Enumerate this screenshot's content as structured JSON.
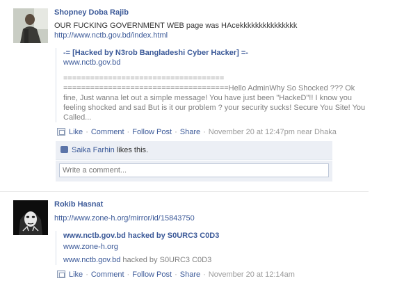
{
  "posts": [
    {
      "author": "Shopney Doba Rajib",
      "message": "OUR FUCKING GOVERNMENT WEB page was HAcekkkkkkkkkkkkkkk",
      "link": "http://www.nctb.gov.bd/index.html",
      "attachment": {
        "title": "-= [Hacked by N3rob Bangladeshi Cyber Hacker] =-",
        "caption": "www.nctb.gov.bd",
        "description_line1": "====================================",
        "description_rest": "=====================================Hello AdminWhy So Shocked ??? Ok fine, Just wanna let out a simple message! You have just been \"HackeD\"!! I know you feeling shocked and sad But is it our problem ? your security sucks! Secure You Site! You Called..."
      },
      "actions": {
        "like": "Like",
        "comment": "Comment",
        "follow": "Follow Post",
        "share": "Share",
        "time": "November 20 at 12:47pm near Dhaka"
      },
      "likes": {
        "name": "Saika Farhin",
        "suffix": "likes this."
      },
      "comment_placeholder": "Write a comment..."
    },
    {
      "author": "Rokib Hasnat",
      "link": "http://www.zone-h.org/mirror/id/15843750",
      "attachment": {
        "title": "www.nctb.gov.bd hacked by S0URC3 C0D3",
        "caption": "www.zone-h.org",
        "desc_link": "www.nctb.gov.bd",
        "desc_text": "hacked by S0URC3 C0D3"
      },
      "actions": {
        "like": "Like",
        "comment": "Comment",
        "follow": "Follow Post",
        "share": "Share",
        "time": "November 20 at 12:14am"
      }
    }
  ],
  "colors": {
    "link": "#3b5998",
    "meta": "#999999",
    "ufi_bg": "#eceff5"
  },
  "icons": {
    "post_icon": "post-type-icon",
    "like": "thumbs-up-icon"
  }
}
